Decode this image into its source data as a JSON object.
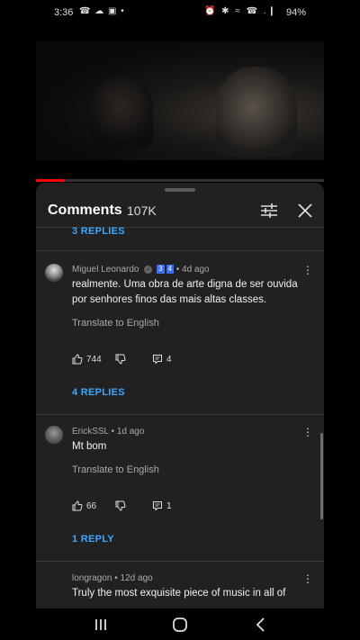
{
  "status_bar": {
    "time": "3:36",
    "left_icons": "☎ ☁ ▣ •",
    "right_icons": "⏰ ✱ ≈ ☎ .❙",
    "battery": "94%"
  },
  "video": {
    "progress_fraction": 0.1
  },
  "comments_panel": {
    "title": "Comments",
    "count": "107K",
    "top_replies_label": "3 REPLIES",
    "comments": [
      {
        "author": "Miguel Leonardo",
        "badge_1": "3",
        "badge_2": "4",
        "time": "• 4d ago",
        "text": "realmente. Uma obra de arte digna de ser ouvida por senhores finos das mais altas classes.",
        "translate": "Translate to English",
        "likes": "744",
        "replies_count": "4",
        "replies_label": "4 REPLIES"
      },
      {
        "author": "ErickSSL",
        "time": "• 1d ago",
        "text": "Mt bom",
        "translate": "Translate to English",
        "likes": "66",
        "replies_count": "1",
        "replies_label": "1 REPLY"
      },
      {
        "author": "longragon",
        "time": "• 12d ago",
        "text": "Truly the most exquisite piece of music in all of"
      }
    ]
  },
  "icons": {
    "filter": "sliders-icon",
    "close": "close-icon",
    "like": "thumbs-up-icon",
    "dislike": "thumbs-down-icon",
    "reply": "reply-icon",
    "more": "kebab-icon"
  },
  "colors": {
    "accent_link": "#3ea6ff",
    "sheet_bg": "#212121",
    "progress": "#ff0000"
  }
}
